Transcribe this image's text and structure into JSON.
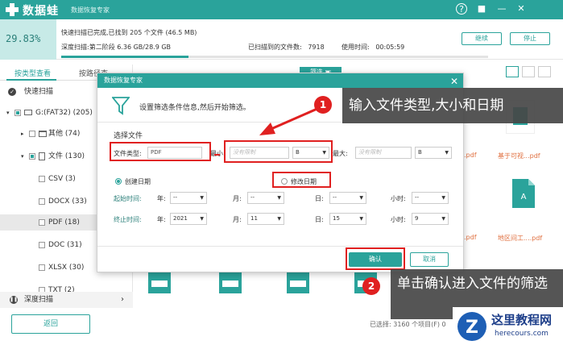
{
  "app": {
    "name": "数据蛙",
    "subtitle": "数据恢复专家",
    "win_buttons": [
      "?",
      "■",
      "—",
      "✕"
    ]
  },
  "header": {
    "percent": "29.83%",
    "line1": "快速扫描已完成,已找到 205 个文件 (46.5 MB)",
    "line2": "深度扫描:第二阶段 6.36 GB/28.9 GB",
    "found_label": "已扫描到的文件数:",
    "found_count": "7918",
    "time_label": "使用时间:",
    "time_value": "00:05:59",
    "progress": 0.2983,
    "continue_btn": "继续",
    "stop_btn": "停止"
  },
  "left": {
    "tab_type": "按类型查看",
    "tab_path": "按路径查",
    "quick_scan": "快速扫描",
    "drive": "G:(FAT32) (205)",
    "other": "其他 (74)",
    "files": "文件 (130)",
    "csv": "CSV (3)",
    "docx": "DOCX (33)",
    "pdf": "PDF (18)",
    "doc": "DOC (31)",
    "xlsx": "XLSX (30)",
    "txt": "TXT (2)",
    "deep_scan": "深度扫描",
    "back": "返回"
  },
  "right": {
    "search_btn": "筛选 ▣",
    "file_labels": [
      ".pdf",
      "基于可视...pdf",
      "地区间工....pdf",
      ".pdf"
    ],
    "footer": "已选择: 3160 个项目(F)   0"
  },
  "dialog": {
    "title": "数据恢复专家",
    "desc": "设置筛选条件信息,然后开始筛选。",
    "section": "选择文件",
    "type_label": "文件类型:",
    "type_value": "PDF",
    "min_label": "最小:",
    "min_placeholder": "没有限制",
    "min_unit": "B",
    "max_label": "最大:",
    "max_placeholder": "没有限制",
    "max_unit": "B",
    "radio_create": "创建日期",
    "radio_modify": "修改日期",
    "start_label": "起始时间:",
    "end_label": "终止时间:",
    "year": "年:",
    "month": "月:",
    "day": "日:",
    "hour": "小时:",
    "dash": "--",
    "end_year": "2021",
    "end_month": "11",
    "end_day": "15",
    "end_hour": "9",
    "ok": "确认",
    "cancel": "取消"
  },
  "callouts": {
    "one_num": "1",
    "one_text": "输入文件类型,大小和日期",
    "two_num": "2",
    "two_text": "单击确认进入文件的筛选"
  },
  "watermark": {
    "name": "这里教程网",
    "url": "herecours.com"
  },
  "colors": {
    "accent": "#2aa39b",
    "annotation": "#e02020",
    "callout_bg": "#464646"
  }
}
